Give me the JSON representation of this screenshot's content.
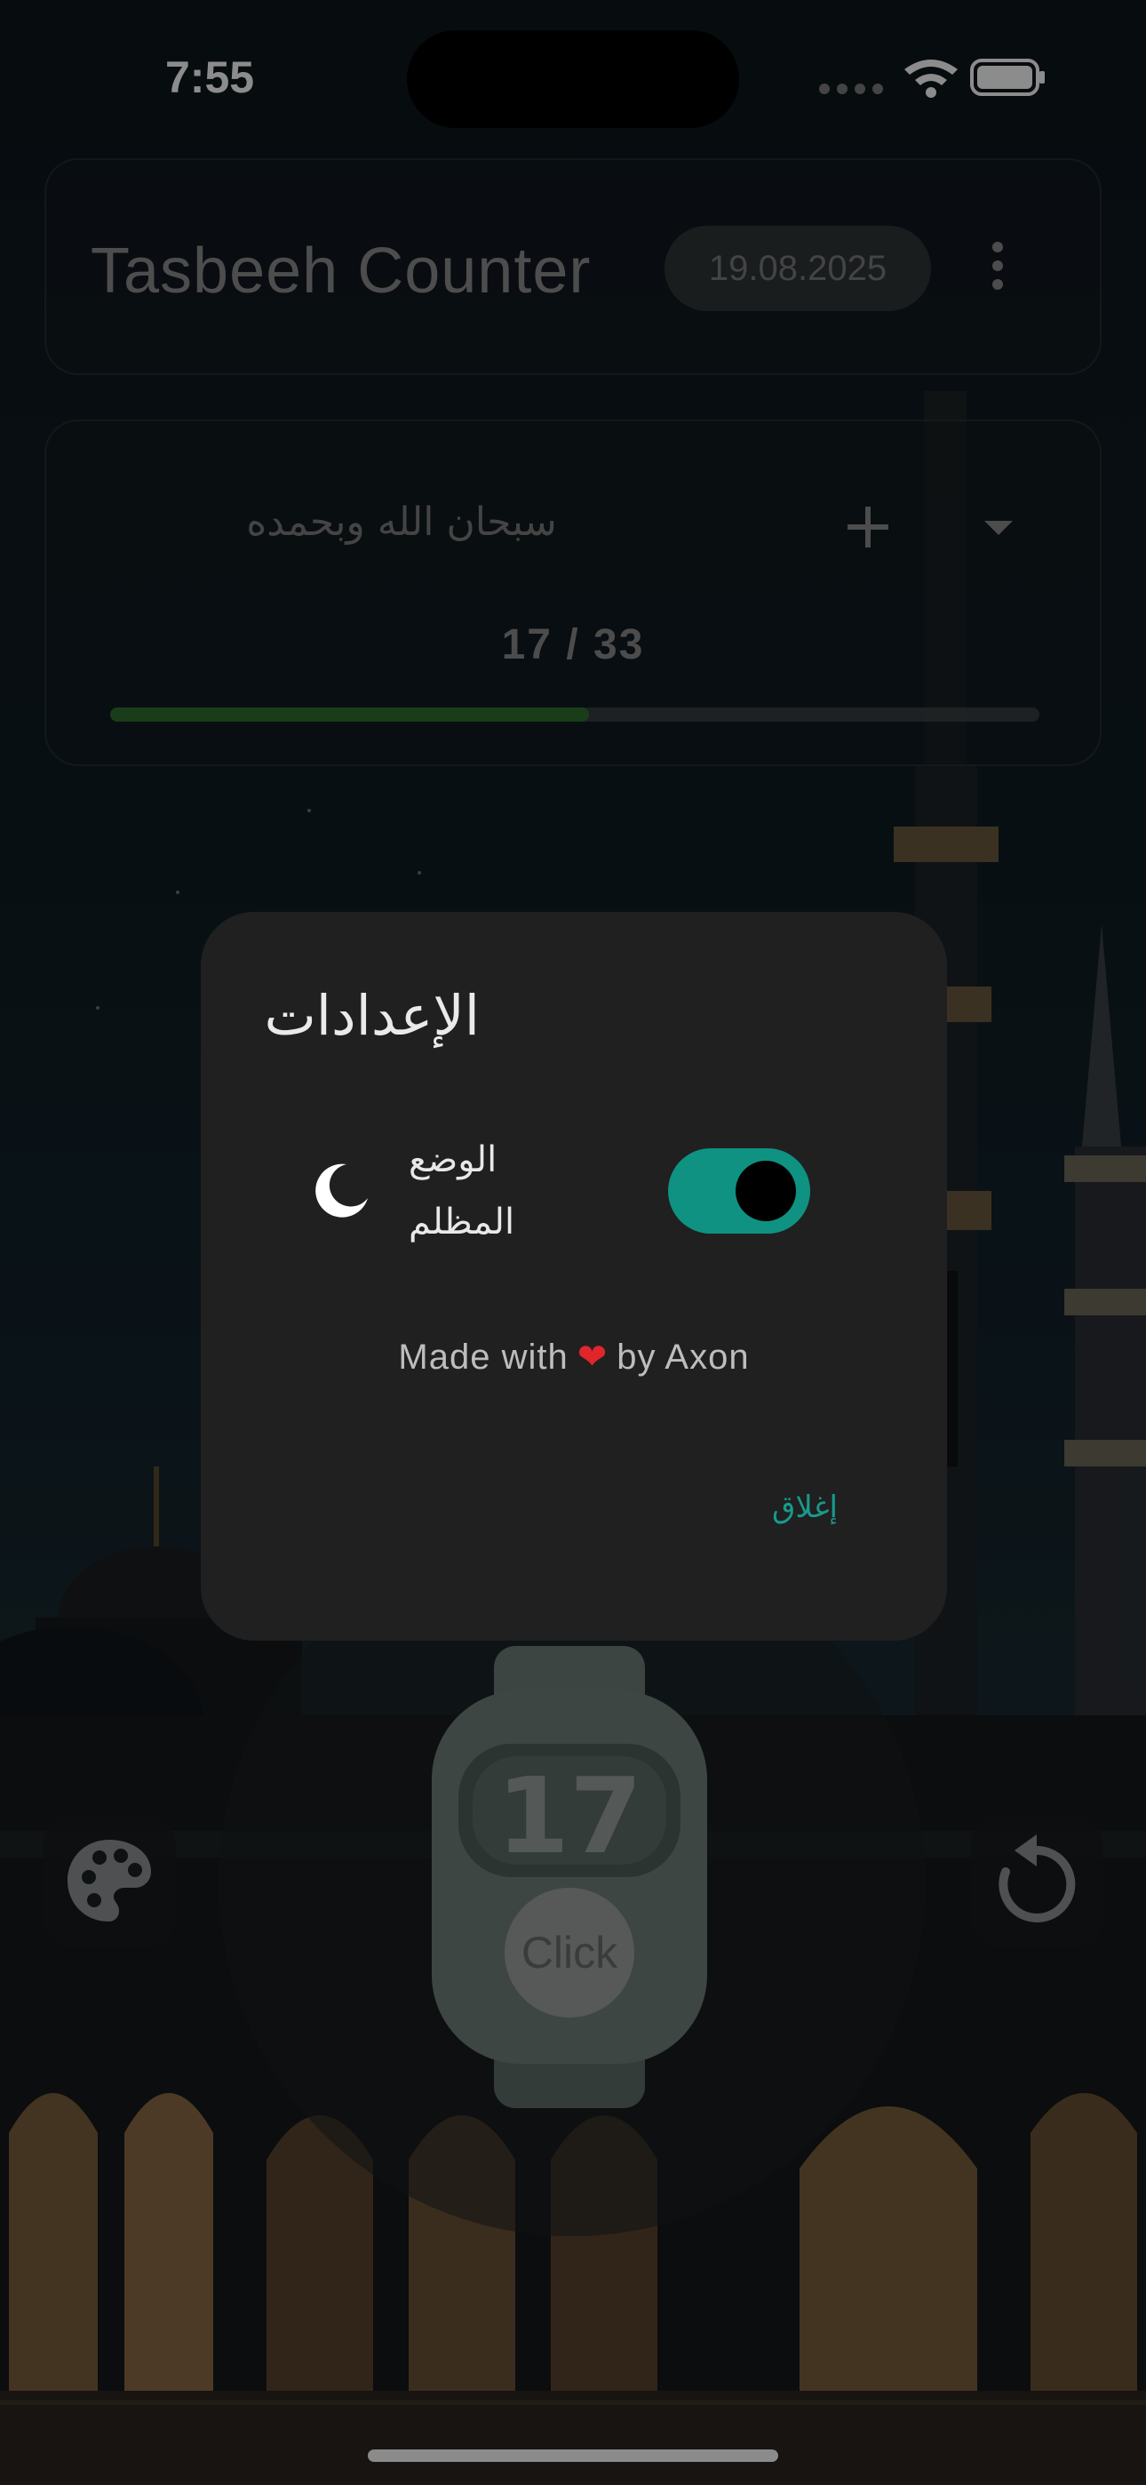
{
  "status_bar": {
    "time": "7:55"
  },
  "header": {
    "title": "Tasbeeh Counter",
    "date": "19.08.2025",
    "menu_icon": "more-vertical-icon"
  },
  "dhikr": {
    "text": "سبحان الله وبحمده",
    "count_text": "17 / 33",
    "progress": 0.515,
    "add_icon": "plus-icon",
    "dropdown_icon": "caret-down-icon"
  },
  "counter": {
    "value": "17",
    "click_label": "Click",
    "theme_icon": "palette-icon",
    "reset_icon": "reset-icon"
  },
  "settings_dialog": {
    "title": "الإعدادات",
    "dark_mode_label": "الوضع المظلم",
    "dark_mode_icon": "moon-icon",
    "dark_mode_enabled": true,
    "credit_prefix": "Made with",
    "credit_suffix": "by Axon",
    "close_label": "إغلاق"
  },
  "colors": {
    "accent": "#0f9282",
    "progress": "#2f6f2f",
    "dialog_bg": "#202020",
    "heart": "#e0262b"
  }
}
